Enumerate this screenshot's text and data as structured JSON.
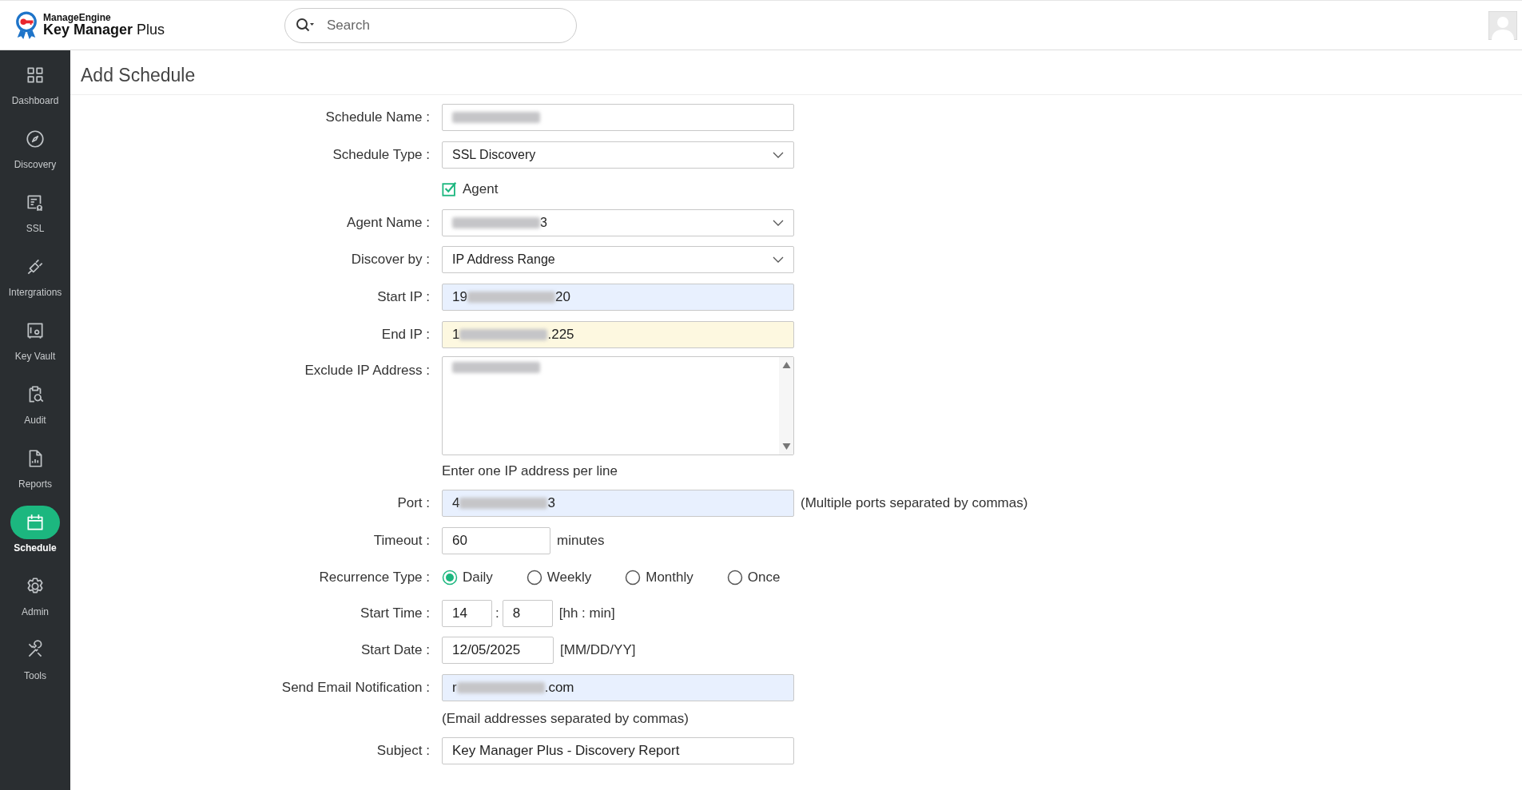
{
  "header": {
    "brand": "ManageEngine",
    "product_bold": "Key Manager",
    "product_light": "Plus",
    "search": {
      "placeholder": "Search"
    }
  },
  "sidebar": {
    "items": [
      {
        "label": "Dashboard",
        "selected": false
      },
      {
        "label": "Discovery",
        "selected": false
      },
      {
        "label": "SSL",
        "selected": false
      },
      {
        "label": "Intergrations",
        "selected": false
      },
      {
        "label": "Key Vault",
        "selected": false
      },
      {
        "label": "Audit",
        "selected": false
      },
      {
        "label": "Reports",
        "selected": false
      },
      {
        "label": "Schedule",
        "selected": true
      },
      {
        "label": "Admin",
        "selected": false
      },
      {
        "label": "Tools",
        "selected": false
      }
    ]
  },
  "page_title": "Add Schedule",
  "form": {
    "rows": [
      {
        "kind": "input",
        "label": "Schedule Name :",
        "redacted": true
      },
      {
        "kind": "select",
        "label": "Schedule Type :",
        "value": "SSL Discovery"
      },
      {
        "kind": "checkbox",
        "label": "Agent",
        "checked": true
      },
      {
        "kind": "select",
        "label": "Agent Name :",
        "redacted": true,
        "value_suffix": "3"
      },
      {
        "kind": "select",
        "label": "Discover by :",
        "value": "IP Address Range"
      },
      {
        "kind": "input",
        "label": "Start IP :",
        "redacted": true,
        "value_prefix": "19",
        "value_suffix": "20",
        "color": "#e8f0fe"
      },
      {
        "kind": "input",
        "label": "End IP :",
        "redacted": true,
        "value_prefix": "1",
        "value_suffix": ".225",
        "color": "#fdf8e0"
      },
      {
        "kind": "textarea",
        "label": "Exclude IP Address :",
        "redacted": true
      },
      {
        "kind": "hint",
        "text": "Enter one IP address per line"
      },
      {
        "kind": "input",
        "label": "Port :",
        "redacted": true,
        "value_prefix": "4",
        "value_suffix": "3",
        "color": "#e8f0fe",
        "note": "(Multiple ports separated by commas)"
      },
      {
        "kind": "short",
        "label": "Timeout :",
        "value": "60",
        "note": "minutes"
      },
      {
        "kind": "radio",
        "label": "Recurrence Type :",
        "options": [
          {
            "label": "Daily",
            "selected": true
          },
          {
            "label": "Weekly",
            "selected": false
          },
          {
            "label": "Monthly",
            "selected": false
          },
          {
            "label": "Once",
            "selected": false
          }
        ]
      },
      {
        "kind": "time",
        "label": "Start Time :",
        "hour": "14",
        "separator": ":",
        "minute": "8",
        "note": "[hh : min]"
      },
      {
        "kind": "date",
        "label": "Start Date :",
        "value": "12/05/2025",
        "note": "[MM/DD/YY]"
      },
      {
        "kind": "input",
        "label": "Send Email Notification :",
        "redacted": true,
        "value_prefix": "r",
        "value_suffix": ".com",
        "color": "#e8f0fe"
      },
      {
        "kind": "hint",
        "text": "(Email addresses separated by commas)"
      },
      {
        "kind": "input",
        "label": "Subject :",
        "value": "Key Manager Plus - Discovery Report"
      }
    ]
  }
}
